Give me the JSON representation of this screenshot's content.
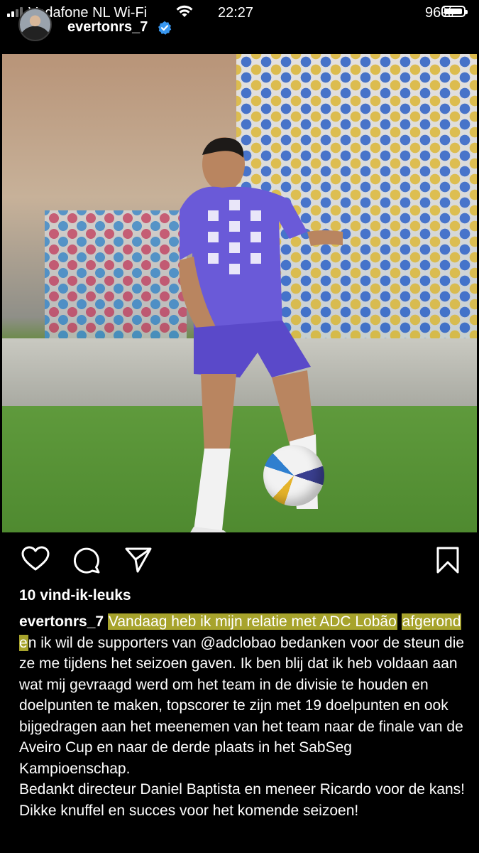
{
  "status_bar": {
    "carrier": "Vodafone NL Wi-Fi",
    "time": "22:27",
    "battery_percent": "96%",
    "battery_level": 0.96
  },
  "header": {
    "username": "evertonrs_7",
    "verified": true
  },
  "post": {
    "image_alt": "photo"
  },
  "actions": {
    "icons": [
      "heart-icon",
      "comment-icon",
      "share-icon",
      "bookmark-icon"
    ]
  },
  "likes": "10 vind-ik-leuks",
  "caption": {
    "username": "evertonrs_7",
    "highlighted_part_1": "Vandaag heb ik mijn relatie met ADC Lobão",
    "highlighted_part_2": "afgerond e",
    "text_after_highlight": "n ik wil de supporters van @adclobao bedanken voor de steun die ze me tijdens het seizoen gaven. Ik ben blij dat ik heb voldaan aan wat mij gevraagd werd om het team in de divisie te houden en doelpunten te maken, topscorer te zijn met 19 doelpunten en ook bijgedragen aan het meenemen van het team naar de finale van de Aveiro Cup en naar de derde plaats in het SabSeg Kampioenschap.",
    "line_2": "Bedankt directeur Daniel Baptista en meneer Ricardo voor de kans!",
    "line_3": "Dikke knuffel en succes voor het komende seizoen!"
  },
  "colors": {
    "background": "#000000",
    "text": "#ffffff",
    "highlight": "#e7e23d",
    "verified_badge": "#3897f0"
  }
}
